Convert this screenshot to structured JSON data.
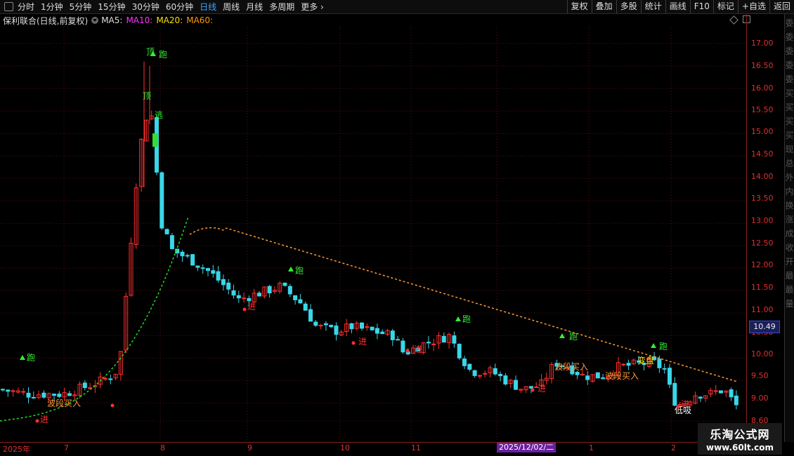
{
  "toolbar": {
    "periods": [
      "分时",
      "1分钟",
      "5分钟",
      "15分钟",
      "30分钟",
      "60分钟",
      "日线",
      "周线",
      "月线",
      "多周期",
      "更多"
    ],
    "active_period": "日线",
    "right_buttons": [
      "复权",
      "叠加",
      "多股",
      "统计",
      "画线",
      "F10",
      "标记",
      "+自选",
      "返回"
    ]
  },
  "info": {
    "stock_name": "保利联合(日线,前复权)",
    "ma5": "MA5:",
    "ma10": "MA10:",
    "ma20": "MA20:",
    "ma60": "MA60:",
    "colors": {
      "ma5": "#dddddd",
      "ma10": "#ff33ff",
      "ma20": "#ffdd00",
      "ma60": "#ff9900"
    }
  },
  "price_axis": {
    "labels": [
      "17.00",
      "16.50",
      "16.00",
      "15.50",
      "15.00",
      "14.50",
      "14.00",
      "13.50",
      "13.00",
      "12.50",
      "12.00",
      "11.50",
      "11.00",
      "10.50",
      "10.00",
      "9.50",
      "9.00",
      "8.60"
    ],
    "current_price": "10.49"
  },
  "time_axis": {
    "labels": [
      "2025年",
      "7",
      "8",
      "9",
      "10",
      "11",
      "2025/12/02/二",
      "1",
      "2"
    ]
  },
  "chart_data": {
    "type": "candlestick",
    "ylim": [
      8.6,
      17.0
    ],
    "colors": {
      "up": "#ff3030",
      "down": "#3ad6e8",
      "ma60": "#ff9933",
      "ma_up": "#22dd22",
      "ma_white": "#ffffff"
    },
    "annotations": [
      {
        "text": "顶",
        "color": "#33ee33"
      },
      {
        "text": "跑",
        "color": "#33ee33"
      },
      {
        "text": "顶",
        "color": "#33ee33"
      },
      {
        "text": "逃",
        "color": "#33ee33"
      },
      {
        "text": "跑",
        "color": "#33ee33"
      },
      {
        "text": "跑",
        "color": "#33ee33"
      },
      {
        "text": "跑",
        "color": "#33ee33"
      },
      {
        "text": "跑",
        "color": "#33ee33"
      },
      {
        "text": "跑",
        "color": "#33ee33"
      },
      {
        "text": "进",
        "color": "#ff3030"
      },
      {
        "text": "进",
        "color": "#ff3030"
      },
      {
        "text": "进",
        "color": "#ff3030"
      },
      {
        "text": "进",
        "color": "#ff3030"
      },
      {
        "text": "进",
        "color": "#ff3030"
      },
      {
        "text": "进",
        "color": "#ff3030"
      },
      {
        "text": "波段买入",
        "color": "#ff9933"
      },
      {
        "text": "波段买入",
        "color": "#ff9933"
      },
      {
        "text": "波段买入",
        "color": "#ff9933"
      },
      {
        "text": "变盘",
        "color": "#ffdd00"
      },
      {
        "text": "低吸",
        "color": "#ffffff"
      }
    ]
  },
  "side_panel": {
    "glyphs": [
      "委",
      "委",
      "委",
      "委",
      "委",
      "买",
      "买",
      "买",
      "买",
      "现",
      "总",
      "外",
      "内",
      "换",
      "涨",
      "成",
      "收",
      "开",
      "最",
      "最",
      "量"
    ]
  },
  "watermark": {
    "line1": "乐淘公式网",
    "line2": "www.60lt.com"
  }
}
